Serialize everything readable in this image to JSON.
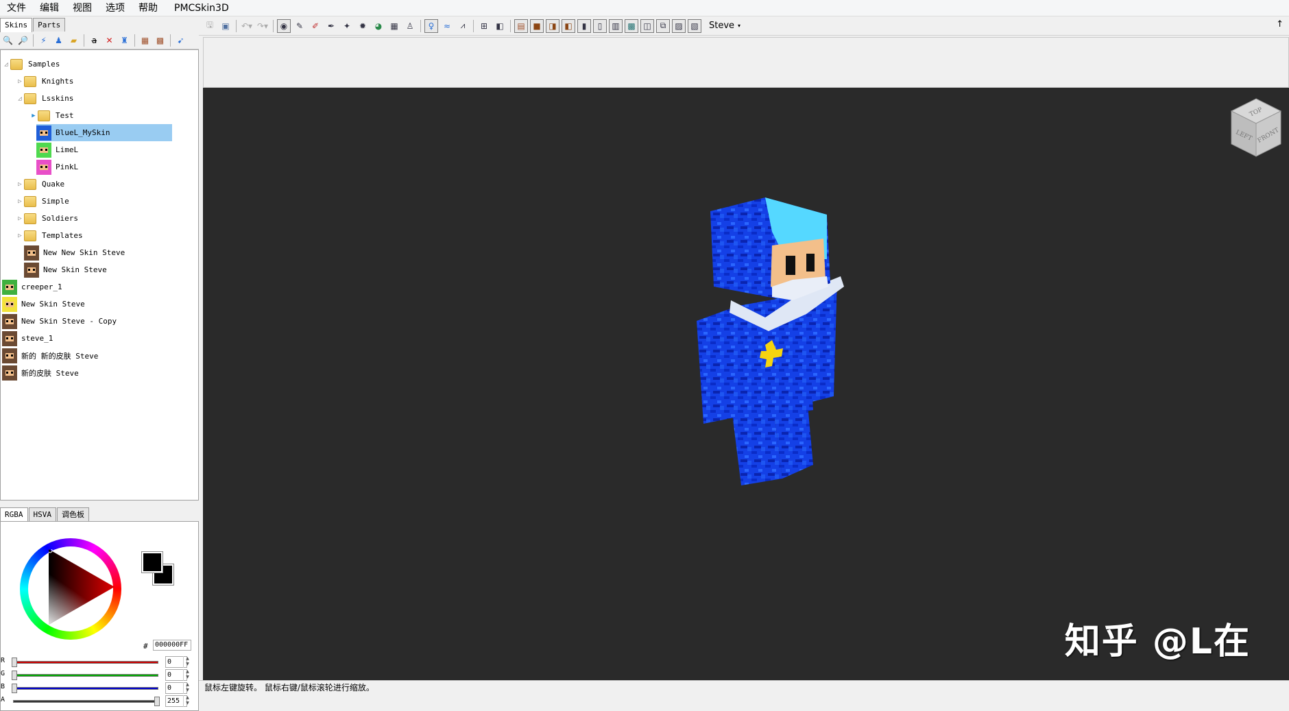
{
  "menu": [
    "文件",
    "编辑",
    "视图",
    "选项",
    "帮助"
  ],
  "app_title": "PMCSkin3D",
  "left_tabs": [
    "Skins",
    "Parts"
  ],
  "tree": [
    {
      "label": "Samples",
      "kind": "folder",
      "depth": 0,
      "expanded": true
    },
    {
      "label": "Knights",
      "kind": "folder",
      "depth": 1,
      "expanded": false
    },
    {
      "label": "Lsskins",
      "kind": "folder",
      "depth": 1,
      "expanded": true
    },
    {
      "label": "Test",
      "kind": "folder",
      "depth": 2,
      "expanded": false
    },
    {
      "label": "BlueL_MySkin",
      "kind": "skin",
      "depth": 2,
      "selected": true,
      "color": "#1f5fd9"
    },
    {
      "label": "LimeL",
      "kind": "skin",
      "depth": 2,
      "color": "#4fd94f"
    },
    {
      "label": "PinkL",
      "kind": "skin",
      "depth": 2,
      "color": "#e84fc8"
    },
    {
      "label": "Quake",
      "kind": "folder",
      "depth": 1,
      "expanded": false
    },
    {
      "label": "Simple",
      "kind": "folder",
      "depth": 1,
      "expanded": false
    },
    {
      "label": "Soldiers",
      "kind": "folder",
      "depth": 1,
      "expanded": false
    },
    {
      "label": "Templates",
      "kind": "folder",
      "depth": 1,
      "expanded": false
    },
    {
      "label": "New New Skin Steve",
      "kind": "skin",
      "depth": 1,
      "color": "#6b4a33"
    },
    {
      "label": "New Skin Steve",
      "kind": "skin",
      "depth": 1,
      "color": "#6b4a33"
    },
    {
      "label": "creeper_1",
      "kind": "skin",
      "depth": 0,
      "color": "#3fb03f"
    },
    {
      "label": "New Skin Steve",
      "kind": "skin",
      "depth": 0,
      "color": "#f2e23a"
    },
    {
      "label": "New Skin Steve - Copy",
      "kind": "skin",
      "depth": 0,
      "color": "#6b4a33"
    },
    {
      "label": "steve_1",
      "kind": "skin",
      "depth": 0,
      "color": "#6b4a33"
    },
    {
      "label": "新的 新的皮肤 Steve",
      "kind": "skin",
      "depth": 0,
      "color": "#6b4a33"
    },
    {
      "label": "新的皮肤 Steve",
      "kind": "skin",
      "depth": 0,
      "color": "#6b4a33"
    }
  ],
  "color_tabs": [
    "RGBA",
    "HSVA",
    "调色板"
  ],
  "color": {
    "hex_label": "#",
    "hex": "000000FF",
    "channels": [
      {
        "name": "R",
        "value": "0",
        "color": "#cc0000",
        "level": 0
      },
      {
        "name": "G",
        "value": "0",
        "color": "#00aa00",
        "level": 0
      },
      {
        "name": "B",
        "value": "0",
        "color": "#0000cc",
        "level": 0
      },
      {
        "name": "A",
        "value": "255",
        "color": "#333333",
        "level": 1
      }
    ]
  },
  "toolbar": {
    "model": "Steve",
    "icons": [
      "save-icon",
      "save-all-icon",
      "undo-icon",
      "redo-icon",
      "camera-icon",
      "pencil-icon",
      "eraser-icon",
      "dropper-icon",
      "dodge-icon",
      "darken-icon",
      "noise-icon",
      "fill-icon",
      "stamp-icon",
      "person-icon",
      "water-icon",
      "graph-icon",
      "grid-icon",
      "clone-icon",
      "view-front-icon",
      "view-back-icon",
      "view-left-icon",
      "view-right-icon",
      "view-top-icon",
      "view-bottom-icon",
      "view-head-icon",
      "view-body-icon",
      "view-arms-icon",
      "view-legs-icon",
      "view-overlay-icon",
      "view-all-icon"
    ]
  },
  "view_cube": {
    "top": "TOP",
    "left": "LEFT",
    "front": "FRONT"
  },
  "watermark": "知乎 @L在",
  "status": "鼠标左键旋转。 鼠标右键/鼠标滚轮进行缩放。"
}
